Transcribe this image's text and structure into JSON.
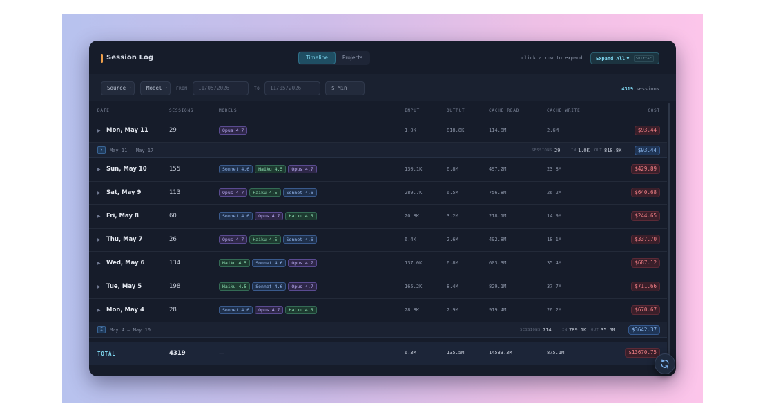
{
  "header": {
    "title": "Session Log",
    "tabs": [
      {
        "label": "Timeline",
        "active": true
      },
      {
        "label": "Projects",
        "active": false
      }
    ],
    "hint": "click a row to expand",
    "expand_label": "Expand All",
    "expand_shortcut": "Shift+E"
  },
  "filters": {
    "source": "Source ·",
    "model": "Model ·",
    "from_label": "FROM",
    "from_placeholder": "11/05/2026",
    "to_label": "TO",
    "to_placeholder": "11/05/2026",
    "min_cost": "$ Min",
    "sessions_count": "4319",
    "sessions_label": "sessions"
  },
  "columns": [
    "DATE",
    "SESSIONS",
    "MODELS",
    "INPUT",
    "OUTPUT",
    "CACHE READ",
    "CACHE WRITE",
    "COST"
  ],
  "week1": {
    "icon": "Σ",
    "range": "May 11 – May 17",
    "sessions_label": "SESSIONS",
    "sessions": "29",
    "in_label": "IN",
    "in": "1.0K",
    "out_label": "OUT",
    "out": "818.8K",
    "cost": "$93.44"
  },
  "week2": {
    "icon": "Σ",
    "range": "May 4 – May 10",
    "sessions_label": "SESSIONS",
    "sessions": "714",
    "in_label": "IN",
    "in": "789.1K",
    "out_label": "OUT",
    "out": "35.5M",
    "cost": "$3642.37"
  },
  "rows": [
    {
      "date": "Mon, May 11",
      "sessions": "29",
      "models": [
        "Opus 4.7"
      ],
      "input": "1.0K",
      "output": "818.8K",
      "cache_read": "114.8M",
      "cache_write": "2.6M",
      "cost": "$93.44"
    },
    {
      "date": "Sun, May 10",
      "sessions": "155",
      "models": [
        "Sonnet 4.6",
        "Haiku 4.5",
        "Opus 4.7"
      ],
      "input": "130.1K",
      "output": "6.8M",
      "cache_read": "497.2M",
      "cache_write": "23.8M",
      "cost": "$429.89"
    },
    {
      "date": "Sat, May 9",
      "sessions": "113",
      "models": [
        "Opus 4.7",
        "Haiku 4.5",
        "Sonnet 4.6"
      ],
      "input": "289.7K",
      "output": "6.5M",
      "cache_read": "756.8M",
      "cache_write": "26.2M",
      "cost": "$640.68"
    },
    {
      "date": "Fri, May 8",
      "sessions": "60",
      "models": [
        "Sonnet 4.6",
        "Opus 4.7",
        "Haiku 4.5"
      ],
      "input": "20.8K",
      "output": "3.2M",
      "cache_read": "218.1M",
      "cache_write": "14.9M",
      "cost": "$244.65"
    },
    {
      "date": "Thu, May 7",
      "sessions": "26",
      "models": [
        "Opus 4.7",
        "Haiku 4.5",
        "Sonnet 4.6"
      ],
      "input": "6.4K",
      "output": "2.6M",
      "cache_read": "492.8M",
      "cache_write": "18.1M",
      "cost": "$337.70"
    },
    {
      "date": "Wed, May 6",
      "sessions": "134",
      "models": [
        "Haiku 4.5",
        "Sonnet 4.6",
        "Opus 4.7"
      ],
      "input": "137.0K",
      "output": "6.8M",
      "cache_read": "603.3M",
      "cache_write": "35.4M",
      "cost": "$687.12"
    },
    {
      "date": "Tue, May 5",
      "sessions": "198",
      "models": [
        "Haiku 4.5",
        "Sonnet 4.6",
        "Opus 4.7"
      ],
      "input": "165.2K",
      "output": "8.4M",
      "cache_read": "829.1M",
      "cache_write": "37.7M",
      "cost": "$711.66"
    },
    {
      "date": "Mon, May 4",
      "sessions": "28",
      "models": [
        "Sonnet 4.6",
        "Opus 4.7",
        "Haiku 4.5"
      ],
      "input": "28.8K",
      "output": "2.9M",
      "cache_read": "919.4M",
      "cache_write": "26.2M",
      "cost": "$670.67"
    }
  ],
  "total": {
    "label": "TOTAL",
    "sessions": "4319",
    "models": "—",
    "input": "6.3M",
    "output": "135.5M",
    "cache_read": "14533.3M",
    "cache_write": "875.1M",
    "cost": "$13670.75"
  },
  "icons": {
    "row_toggle": "chevron-right-icon",
    "refresh": "refresh-icon",
    "week_sum": "sigma-icon"
  },
  "colors": {
    "accent": "#7fd6ef",
    "title_marker": "#f0a04b",
    "cost": "#f07f86",
    "opus": "#b7a8f0",
    "sonnet": "#93b6ee",
    "haiku": "#8fe0b4"
  }
}
